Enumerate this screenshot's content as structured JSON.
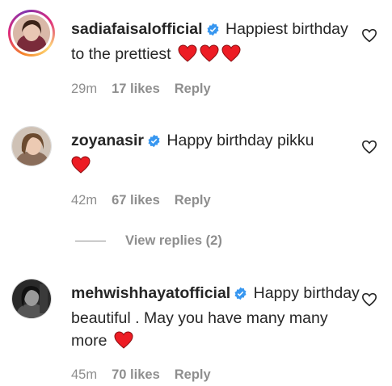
{
  "comments": [
    {
      "username": "sadiafaisalofficial",
      "text": "Happiest birthday to the prettiest",
      "hearts": 3,
      "time": "29m",
      "likes": "17 likes",
      "reply": "Reply",
      "verified": true
    },
    {
      "username": "zoyanasir",
      "text": "Happy birthday pikku",
      "hearts": 1,
      "time": "42m",
      "likes": "67 likes",
      "reply": "Reply",
      "verified": true
    },
    {
      "username": "mehwishhayatofficial",
      "text": "Happy birthday beautiful . May you have many many more",
      "hearts": 1,
      "time": "45m",
      "likes": "70 likes",
      "reply": "Reply",
      "verified": true
    }
  ],
  "view_replies": "View replies (2)",
  "colors": {
    "text": "#262626",
    "meta": "#8e8e8e",
    "verified": "#3897f0",
    "heart": "#ed1c24"
  }
}
